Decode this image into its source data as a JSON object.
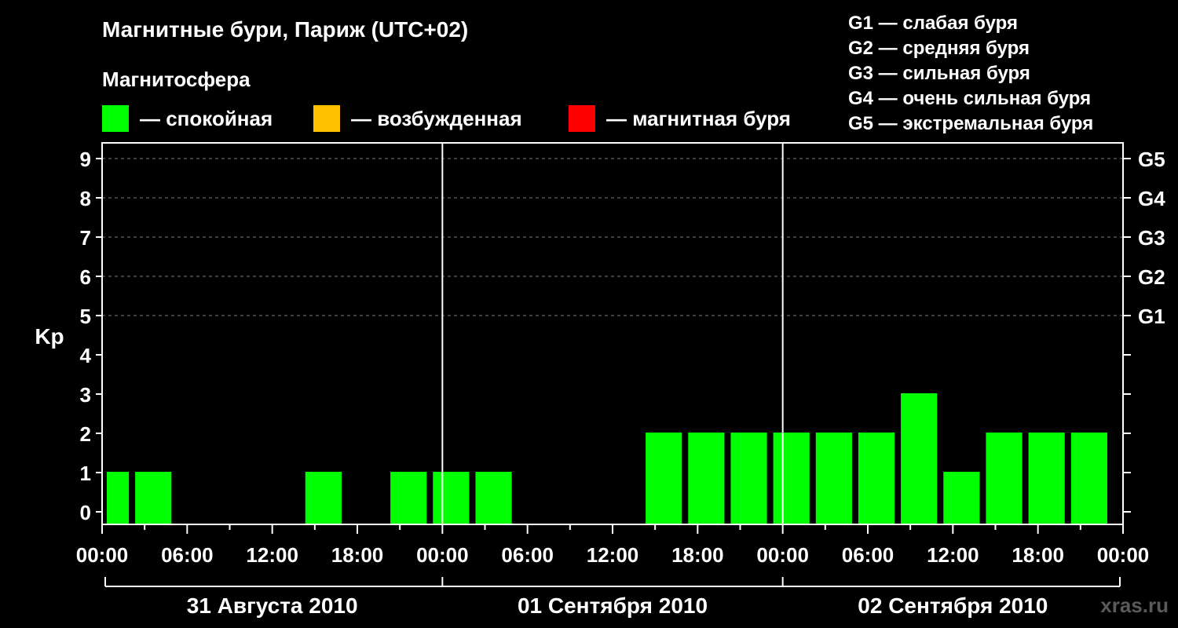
{
  "header": {
    "title": "Магнитные бури, Париж (UTC+02)",
    "subtitle": "Магнитосфера"
  },
  "legend": {
    "items": [
      {
        "label": "— спокойная",
        "color": "#00ff00"
      },
      {
        "label": "— возбужденная",
        "color": "#ffc000"
      },
      {
        "label": "— магнитная буря",
        "color": "#ff0000"
      }
    ]
  },
  "g_legend": [
    "G1 — слабая буря",
    "G2 — средняя буря",
    "G3 — сильная буря",
    "G4 — очень сильная буря",
    "G5 — экстремальная буря"
  ],
  "watermark": "xras.ru",
  "chart_data": {
    "type": "bar",
    "ylabel": "Kp",
    "ylim": [
      0,
      9
    ],
    "y_ticks": [
      "0",
      "1",
      "2",
      "3",
      "4",
      "5",
      "6",
      "7",
      "8",
      "9"
    ],
    "right_ticks": [
      {
        "value": 5,
        "label": "G1"
      },
      {
        "value": 6,
        "label": "G2"
      },
      {
        "value": 7,
        "label": "G3"
      },
      {
        "value": 8,
        "label": "G4"
      },
      {
        "value": 9,
        "label": "G5"
      }
    ],
    "x_tick_labels": [
      "00:00",
      "06:00",
      "12:00",
      "18:00",
      "00:00",
      "06:00",
      "12:00",
      "18:00",
      "00:00",
      "06:00",
      "12:00",
      "18:00",
      "00:00"
    ],
    "days": [
      "31 Августа 2010",
      "01 Сентября 2010",
      "02 Сентября 2010"
    ],
    "x_range_hours": [
      0,
      72
    ],
    "bar_color": "#00ff00",
    "bars": [
      {
        "start_hour": 0,
        "end_hour": 2,
        "kp": 1
      },
      {
        "start_hour": 2,
        "end_hour": 5,
        "kp": 1
      },
      {
        "start_hour": 5,
        "end_hour": 8,
        "kp": 0
      },
      {
        "start_hour": 8,
        "end_hour": 11,
        "kp": 0
      },
      {
        "start_hour": 11,
        "end_hour": 14,
        "kp": 0
      },
      {
        "start_hour": 14,
        "end_hour": 17,
        "kp": 1
      },
      {
        "start_hour": 17,
        "end_hour": 20,
        "kp": 0
      },
      {
        "start_hour": 20,
        "end_hour": 23,
        "kp": 1
      },
      {
        "start_hour": 23,
        "end_hour": 26,
        "kp": 1
      },
      {
        "start_hour": 26,
        "end_hour": 29,
        "kp": 1
      },
      {
        "start_hour": 29,
        "end_hour": 32,
        "kp": 0
      },
      {
        "start_hour": 32,
        "end_hour": 35,
        "kp": 0
      },
      {
        "start_hour": 35,
        "end_hour": 38,
        "kp": 0
      },
      {
        "start_hour": 38,
        "end_hour": 41,
        "kp": 2
      },
      {
        "start_hour": 41,
        "end_hour": 44,
        "kp": 2
      },
      {
        "start_hour": 44,
        "end_hour": 47,
        "kp": 2
      },
      {
        "start_hour": 47,
        "end_hour": 50,
        "kp": 2
      },
      {
        "start_hour": 50,
        "end_hour": 53,
        "kp": 2
      },
      {
        "start_hour": 53,
        "end_hour": 56,
        "kp": 2
      },
      {
        "start_hour": 56,
        "end_hour": 59,
        "kp": 3
      },
      {
        "start_hour": 59,
        "end_hour": 62,
        "kp": 1
      },
      {
        "start_hour": 62,
        "end_hour": 65,
        "kp": 2
      },
      {
        "start_hour": 65,
        "end_hour": 68,
        "kp": 2
      },
      {
        "start_hour": 68,
        "end_hour": 71,
        "kp": 2
      }
    ]
  }
}
